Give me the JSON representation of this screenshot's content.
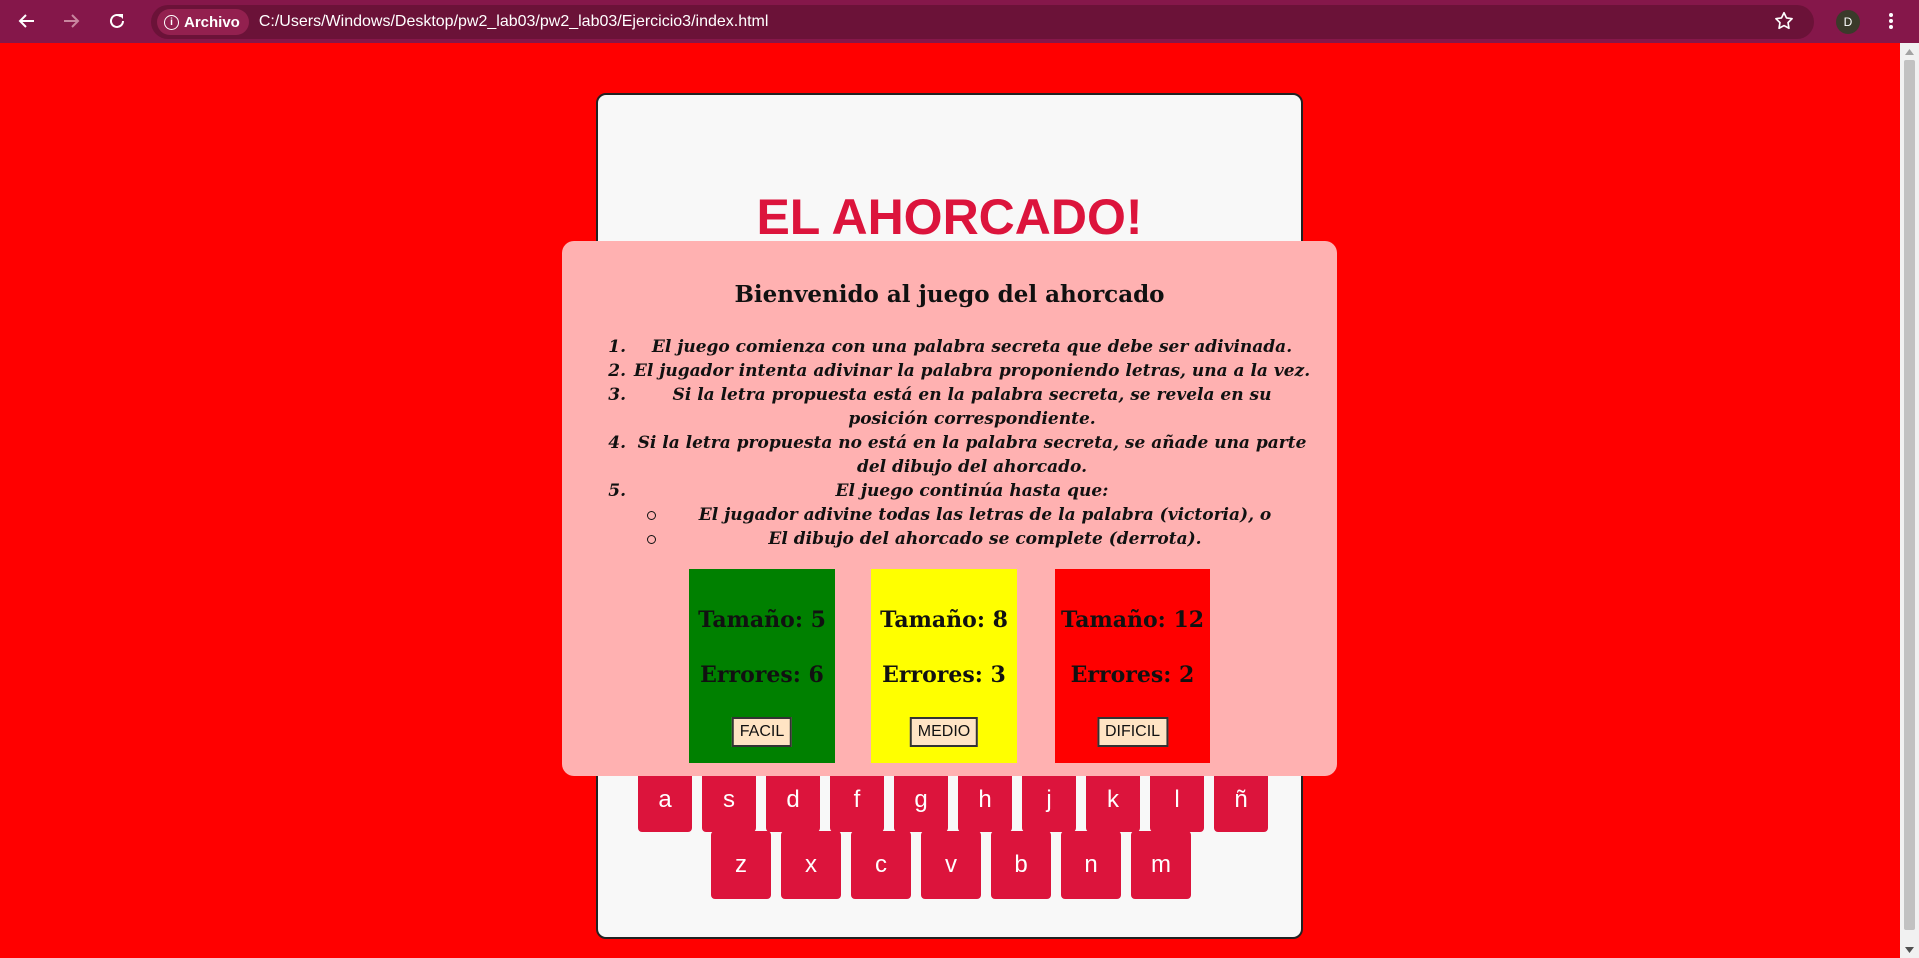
{
  "browser": {
    "site_chip": "Archivo",
    "url": "C:/Users/Windows/Desktop/pw2_lab03/pw2_lab03/Ejercicio3/index.html",
    "avatar_letter": "D"
  },
  "game": {
    "title": "EL AHORCADO!",
    "keyboard_row_a": [
      "a",
      "s",
      "d",
      "f",
      "g",
      "h",
      "j",
      "k",
      "l",
      "ñ"
    ],
    "keyboard_row_z": [
      "z",
      "x",
      "c",
      "v",
      "b",
      "n",
      "m"
    ]
  },
  "modal": {
    "title": "Bienvenido al juego del ahorcado",
    "rules": [
      {
        "num": "1.",
        "text": "El juego comienza con una palabra secreta que debe ser adivinada."
      },
      {
        "num": "2.",
        "text": "El jugador intenta adivinar la palabra proponiendo letras, una a la vez."
      },
      {
        "num": "3.",
        "text": "Si la letra propuesta está en la palabra secreta, se revela en su posición correspondiente."
      },
      {
        "num": "4.",
        "text": "Si la letra propuesta no está en la palabra secreta, se añade una parte del dibujo del ahorcado."
      },
      {
        "num": "5.",
        "text": "El juego continúa hasta que:"
      }
    ],
    "subrules": [
      "El jugador adivine todas las letras de la palabra (victoria), o",
      "El dibujo del ahorcado se complete (derrota)."
    ],
    "levels": [
      {
        "size": "Tamaño: 5",
        "errors": "Errores: 6",
        "button": "FACIL",
        "color": "#008000"
      },
      {
        "size": "Tamaño: 8",
        "errors": "Errores: 3",
        "button": "MEDIO",
        "color": "#ffff00"
      },
      {
        "size": "Tamaño: 12",
        "errors": "Errores: 2",
        "button": "DIFICIL",
        "color": "#ff0000"
      }
    ]
  },
  "colors": {
    "page_bg": "#ff0000",
    "accent": "#dc143c",
    "modal_bg": "#ffb1b1",
    "browser_bar": "#85174a"
  }
}
